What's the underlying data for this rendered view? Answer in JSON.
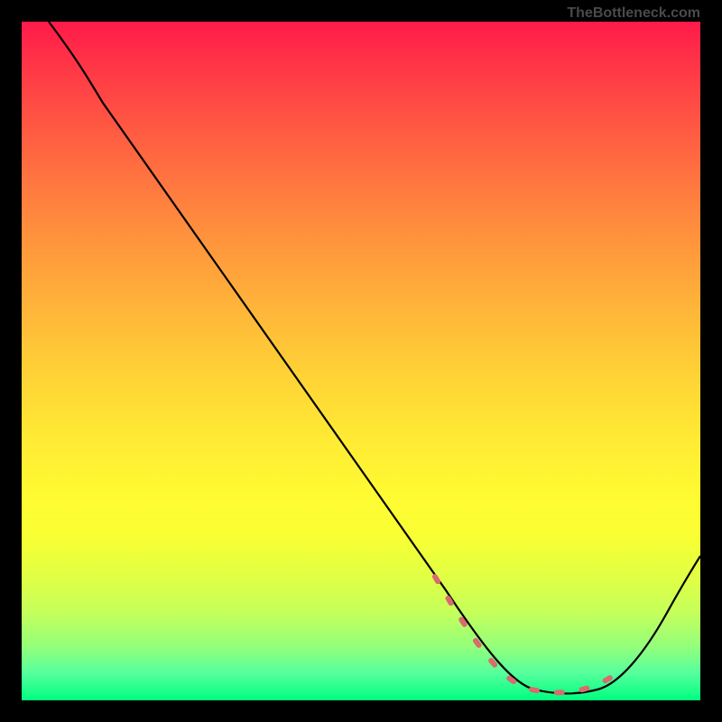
{
  "attribution": "TheBottleneck.com",
  "chart_data": {
    "type": "line",
    "title": "",
    "xlabel": "",
    "ylabel": "",
    "xlim": [
      0,
      100
    ],
    "ylim": [
      0,
      100
    ],
    "x": [
      4,
      10,
      20,
      30,
      40,
      50,
      55,
      60,
      62,
      68,
      70,
      75,
      80,
      82,
      86,
      90,
      95,
      99
    ],
    "values": [
      100,
      91,
      78,
      63,
      49,
      35,
      28,
      20,
      17,
      8,
      5,
      2,
      1,
      1,
      1.5,
      4,
      11,
      17
    ],
    "series": [
      {
        "name": "bottleneck-curve",
        "x": [
          4,
          10,
          20,
          30,
          40,
          50,
          55,
          60,
          62,
          68,
          70,
          75,
          80,
          82,
          86,
          90,
          95,
          99
        ],
        "values": [
          100,
          91,
          78,
          63,
          49,
          35,
          28,
          20,
          17,
          8,
          5,
          2,
          1,
          1,
          1.5,
          4,
          11,
          17
        ]
      }
    ],
    "highlight_range_x": [
      60,
      90
    ]
  },
  "colors": {
    "gradient_top": "#ff1a4a",
    "gradient_bottom": "#00ff7f",
    "curve": "#000000",
    "highlight_dash": "#d86b6e"
  }
}
